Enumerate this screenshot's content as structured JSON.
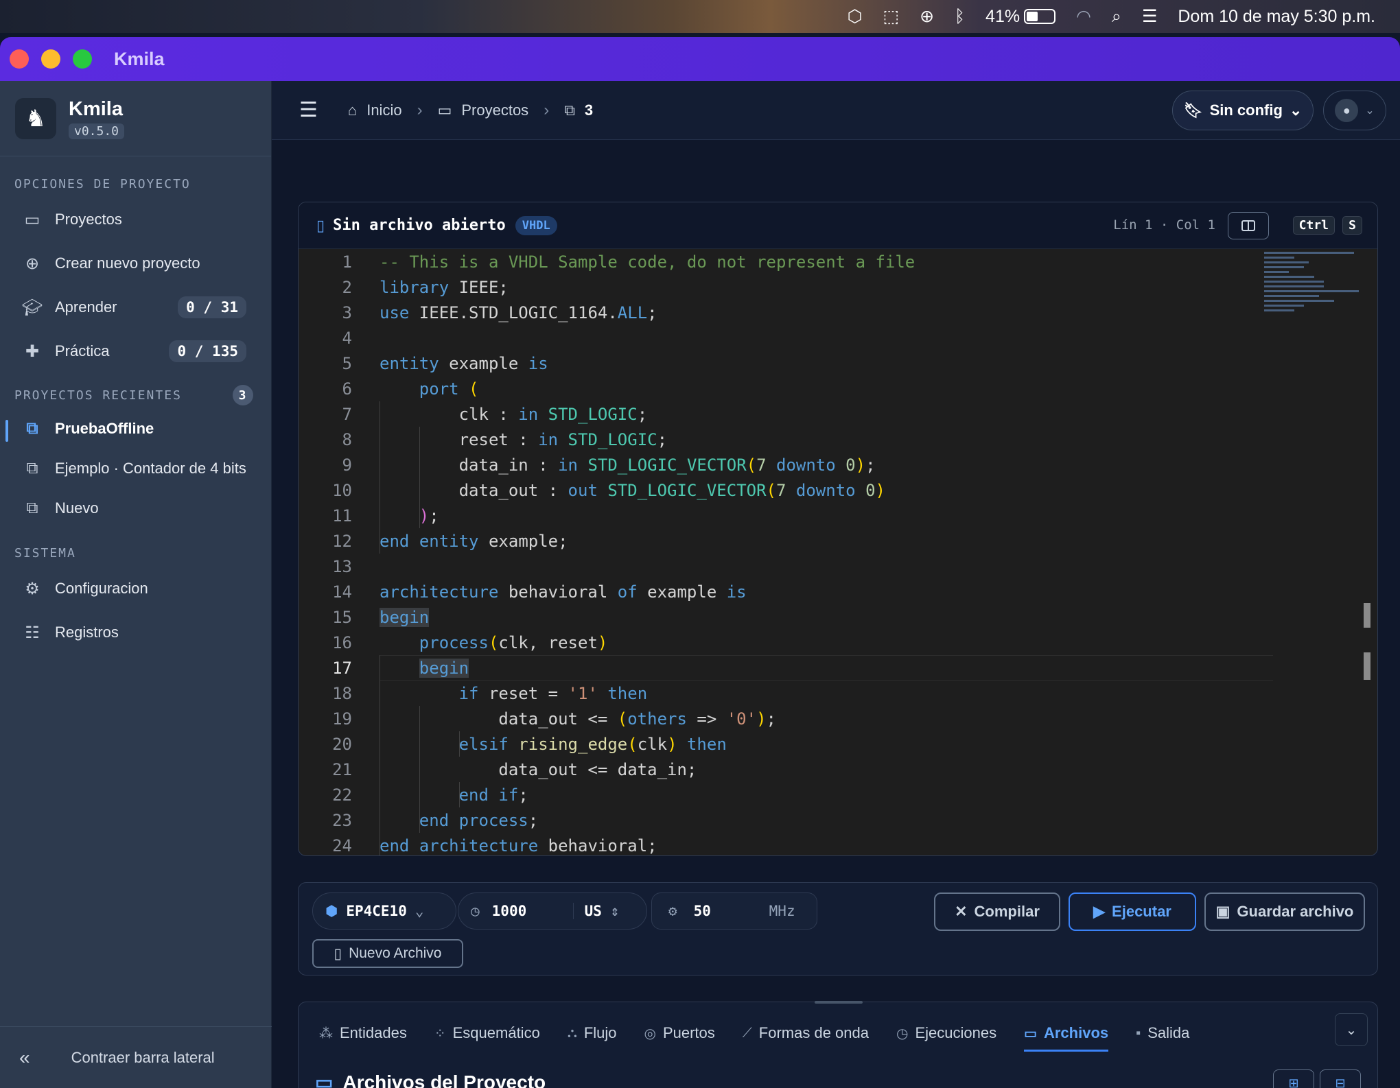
{
  "menubar": {
    "battery": "41%",
    "battery_level": 0.41,
    "datetime": "Dom 10 de may  5:30 p.m."
  },
  "window": {
    "title": "Kmila"
  },
  "sidebar": {
    "app_name": "Kmila",
    "version": "v0.5.0",
    "section_project": "OPCIONES DE PROYECTO",
    "project_items": [
      {
        "label": "Proyectos",
        "icon": "folder-icon"
      },
      {
        "label": "Crear nuevo proyecto",
        "icon": "plus-circle-icon"
      },
      {
        "label": "Aprender",
        "icon": "graduation-cap-icon",
        "badge": "0 / 31"
      },
      {
        "label": "Práctica",
        "icon": "puzzle-icon",
        "badge": "0 / 135"
      }
    ],
    "section_recent": "PROYECTOS RECIENTES",
    "recent_count": "3",
    "recent_items": [
      {
        "label": "PruebaOffline",
        "active": true
      },
      {
        "label": "Ejemplo · Contador de 4 bits"
      },
      {
        "label": "Nuevo"
      }
    ],
    "section_system": "SISTEMA",
    "system_items": [
      {
        "label": "Configuracion",
        "icon": "gear-icon"
      },
      {
        "label": "Registros",
        "icon": "logs-icon"
      }
    ],
    "collapse_label": "Contraer barra lateral"
  },
  "topbar": {
    "breadcrumb": [
      "Inicio",
      "Proyectos",
      "3"
    ],
    "config_label": "Sin config"
  },
  "editor": {
    "file_label": "Sin archivo abierto",
    "language": "VHDL",
    "position": "Lín 1 · Col 1",
    "shortcut": [
      "Ctrl",
      "S"
    ],
    "current_line": 17,
    "lines": [
      "-- This is a VHDL Sample code, do not represent a file",
      "library IEEE;",
      "use IEEE.STD_LOGIC_1164.ALL;",
      "",
      "entity example is",
      "    port (",
      "        clk : in STD_LOGIC;",
      "        reset : in STD_LOGIC;",
      "        data_in : in STD_LOGIC_VECTOR(7 downto 0);",
      "        data_out : out STD_LOGIC_VECTOR(7 downto 0)",
      "    );",
      "end entity example;",
      "",
      "architecture behavioral of example is",
      "begin",
      "    process(clk, reset)",
      "    begin",
      "        if reset = '1' then",
      "            data_out <= (others => '0');",
      "        elsif rising_edge(clk) then",
      "            data_out <= data_in;",
      "        end if;",
      "    end process;",
      "end architecture behavioral;"
    ]
  },
  "toolbar": {
    "device": "EP4CE10",
    "time_value": "1000",
    "time_unit": "US",
    "freq_value": "50",
    "freq_unit": "MHz",
    "compile_label": "Compilar",
    "run_label": "Ejecutar",
    "save_label": "Guardar archivo",
    "new_file_label": "Nuevo Archivo"
  },
  "panel": {
    "tabs": [
      {
        "label": "Entidades",
        "icon": "hierarchy-icon"
      },
      {
        "label": "Esquemático",
        "icon": "schematic-icon"
      },
      {
        "label": "Flujo",
        "icon": "flow-icon"
      },
      {
        "label": "Puertos",
        "icon": "ports-icon"
      },
      {
        "label": "Formas de onda",
        "icon": "chart-line-icon"
      },
      {
        "label": "Ejecuciones",
        "icon": "clock-icon"
      },
      {
        "label": "Archivos",
        "icon": "folder-icon",
        "active": true
      },
      {
        "label": "Salida",
        "icon": "terminal-icon"
      }
    ],
    "title": "Archivos del Proyecto"
  }
}
